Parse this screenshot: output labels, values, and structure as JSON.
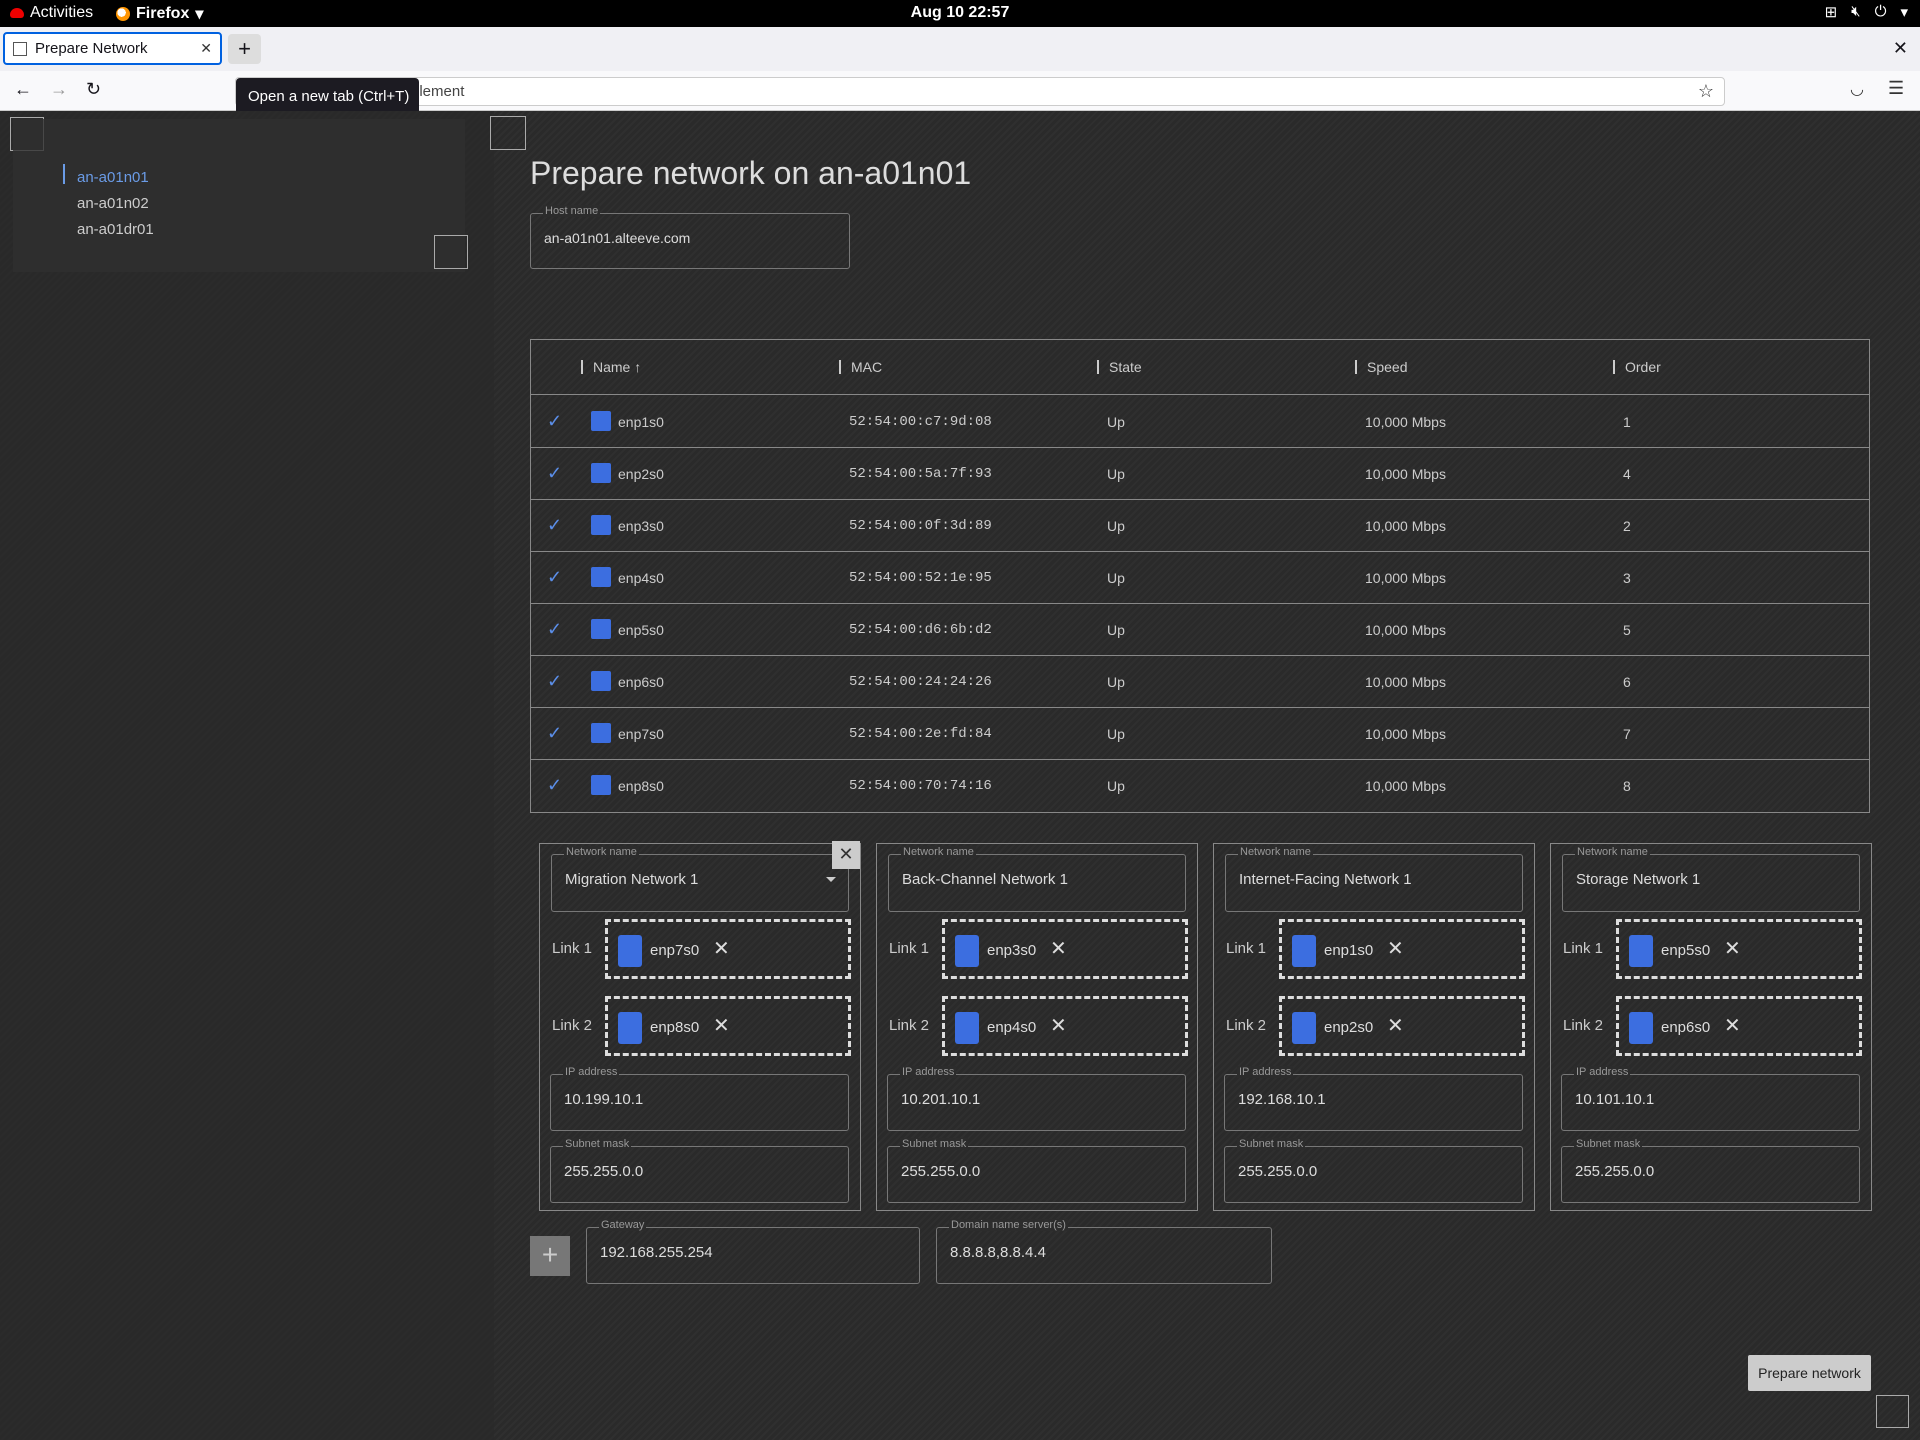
{
  "system_bar": {
    "activities": "Activities",
    "app_menu": "Firefox",
    "clock": "Aug 10  22:57"
  },
  "browser": {
    "tab_title": "Prepare Network",
    "tooltip": "Open a new tab (Ctrl+T)",
    "url_text": "element"
  },
  "sidebar": {
    "nodes": [
      "an-a01n01",
      "an-a01n02",
      "an-a01dr01"
    ],
    "active_node": "an-a01n01"
  },
  "main": {
    "title": "Prepare network on an-a01n01",
    "host_name": {
      "label": "Host name",
      "value": "an-a01n01.alteeve.com"
    }
  },
  "table": {
    "columns": [
      "Name",
      "MAC",
      "State",
      "Speed",
      "Order"
    ],
    "sort_indicator": "↑",
    "rows": [
      {
        "name": "enp1s0",
        "mac": "52:54:00:c7:9d:08",
        "state": "Up",
        "speed": "10,000 Mbps",
        "order": "1"
      },
      {
        "name": "enp2s0",
        "mac": "52:54:00:5a:7f:93",
        "state": "Up",
        "speed": "10,000 Mbps",
        "order": "4"
      },
      {
        "name": "enp3s0",
        "mac": "52:54:00:0f:3d:89",
        "state": "Up",
        "speed": "10,000 Mbps",
        "order": "2"
      },
      {
        "name": "enp4s0",
        "mac": "52:54:00:52:1e:95",
        "state": "Up",
        "speed": "10,000 Mbps",
        "order": "3"
      },
      {
        "name": "enp5s0",
        "mac": "52:54:00:d6:6b:d2",
        "state": "Up",
        "speed": "10,000 Mbps",
        "order": "5"
      },
      {
        "name": "enp6s0",
        "mac": "52:54:00:24:24:26",
        "state": "Up",
        "speed": "10,000 Mbps",
        "order": "6"
      },
      {
        "name": "enp7s0",
        "mac": "52:54:00:2e:fd:84",
        "state": "Up",
        "speed": "10,000 Mbps",
        "order": "7"
      },
      {
        "name": "enp8s0",
        "mac": "52:54:00:70:74:16",
        "state": "Up",
        "speed": "10,000 Mbps",
        "order": "8"
      }
    ]
  },
  "labels": {
    "network_name": "Network name",
    "link1": "Link 1",
    "link2": "Link 2",
    "ip_address": "IP address",
    "subnet_mask": "Subnet mask"
  },
  "networks": [
    {
      "name": "Migration Network 1",
      "link1": "enp7s0",
      "link2": "enp8s0",
      "ip": "10.199.10.1",
      "mask": "255.255.0.0"
    },
    {
      "name": "Back-Channel Network 1",
      "link1": "enp3s0",
      "link2": "enp4s0",
      "ip": "10.201.10.1",
      "mask": "255.255.0.0"
    },
    {
      "name": "Internet-Facing Network 1",
      "link1": "enp1s0",
      "link2": "enp2s0",
      "ip": "192.168.10.1",
      "mask": "255.255.0.0"
    },
    {
      "name": "Storage Network 1",
      "link1": "enp5s0",
      "link2": "enp6s0",
      "ip": "10.101.10.1",
      "mask": "255.255.0.0"
    }
  ],
  "gateway": {
    "label": "Gateway",
    "value": "192.168.255.254"
  },
  "dns": {
    "label": "Domain name server(s)",
    "value": "8.8.8.8,8.8.4.4"
  },
  "actions": {
    "add": "+",
    "submit": "Prepare network"
  },
  "colors": {
    "accent": "#3c6ee0",
    "active_link": "#6a9be6"
  }
}
